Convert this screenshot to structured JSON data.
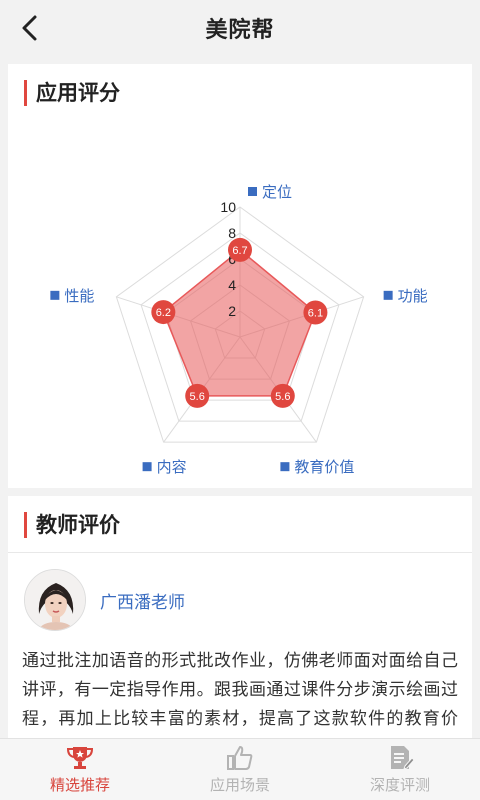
{
  "header": {
    "title": "美院帮",
    "back_icon": "chevron-left-icon"
  },
  "score_section": {
    "title": "应用评分"
  },
  "chart_data": {
    "type": "radar",
    "axes": [
      "定位",
      "功能",
      "教育价值",
      "内容",
      "性能"
    ],
    "values": [
      6.7,
      6.1,
      5.6,
      5.6,
      6.2
    ],
    "value_labels": [
      "6.7",
      "6.1",
      "5.6",
      "5.6",
      "6.2"
    ],
    "range": [
      0,
      10
    ],
    "ticks": [
      "10",
      "8",
      "6",
      "4",
      "2"
    ],
    "fill_color": "#e8595a",
    "axis_label_color": "#3a6cc0",
    "marker_color": "#e0473f"
  },
  "teacher_section": {
    "title": "教师评价",
    "teacher_name": "广西潘老师",
    "review": "通过批注加语音的形式批改作业，仿佛老师面对面给自己讲评，有一定指导作用。跟我画通过课件分步演示绘画过程，再加上比较丰富的素材，提高了这款软件的教育价值，值得一用。"
  },
  "tabs": [
    {
      "label": "精选推荐",
      "icon": "trophy-icon",
      "active": true
    },
    {
      "label": "应用场景",
      "icon": "thumbs-up-icon",
      "active": false
    },
    {
      "label": "深度评测",
      "icon": "document-edit-icon",
      "active": false
    }
  ],
  "colors": {
    "accent": "#d8453d",
    "link": "#3a6cc0"
  }
}
